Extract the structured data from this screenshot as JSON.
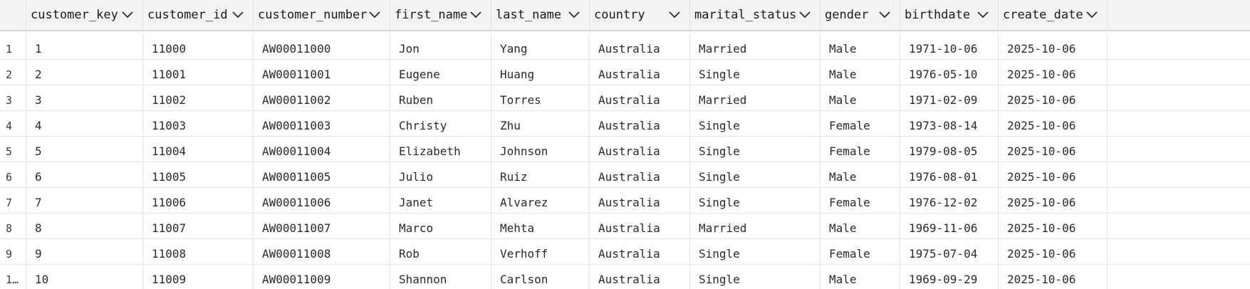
{
  "table": {
    "columns": [
      {
        "label": ""
      },
      {
        "label": "customer_key"
      },
      {
        "label": "customer_id"
      },
      {
        "label": "customer_number"
      },
      {
        "label": "first_name"
      },
      {
        "label": "last_name"
      },
      {
        "label": "country"
      },
      {
        "label": "marital_status"
      },
      {
        "label": "gender"
      },
      {
        "label": "birthdate"
      },
      {
        "label": "create_date"
      }
    ],
    "sort_icon": "chevron-down-icon",
    "rows": [
      {
        "n": "1",
        "cells": [
          "1",
          "11000",
          "AW00011000",
          "Jon",
          "Yang",
          "Australia",
          "Married",
          "Male",
          "1971-10-06",
          "2025-10-06"
        ]
      },
      {
        "n": "2",
        "cells": [
          "2",
          "11001",
          "AW00011001",
          "Eugene",
          "Huang",
          "Australia",
          "Single",
          "Male",
          "1976-05-10",
          "2025-10-06"
        ]
      },
      {
        "n": "3",
        "cells": [
          "3",
          "11002",
          "AW00011002",
          "Ruben",
          "Torres",
          "Australia",
          "Married",
          "Male",
          "1971-02-09",
          "2025-10-06"
        ]
      },
      {
        "n": "4",
        "cells": [
          "4",
          "11003",
          "AW00011003",
          "Christy",
          "Zhu",
          "Australia",
          "Single",
          "Female",
          "1973-08-14",
          "2025-10-06"
        ]
      },
      {
        "n": "5",
        "cells": [
          "5",
          "11004",
          "AW00011004",
          "Elizabeth",
          "Johnson",
          "Australia",
          "Single",
          "Female",
          "1979-08-05",
          "2025-10-06"
        ]
      },
      {
        "n": "6",
        "cells": [
          "6",
          "11005",
          "AW00011005",
          "Julio",
          "Ruiz",
          "Australia",
          "Single",
          "Male",
          "1976-08-01",
          "2025-10-06"
        ]
      },
      {
        "n": "7",
        "cells": [
          "7",
          "11006",
          "AW00011006",
          "Janet",
          "Alvarez",
          "Australia",
          "Single",
          "Female",
          "1976-12-02",
          "2025-10-06"
        ]
      },
      {
        "n": "8",
        "cells": [
          "8",
          "11007",
          "AW00011007",
          "Marco",
          "Mehta",
          "Australia",
          "Married",
          "Male",
          "1969-11-06",
          "2025-10-06"
        ]
      },
      {
        "n": "9",
        "cells": [
          "9",
          "11008",
          "AW00011008",
          "Rob",
          "Verhoff",
          "Australia",
          "Single",
          "Female",
          "1975-07-04",
          "2025-10-06"
        ]
      },
      {
        "n": "1…",
        "cells": [
          "10",
          "11009",
          "AW00011009",
          "Shannon",
          "Carlson",
          "Australia",
          "Single",
          "Male",
          "1969-09-29",
          "2025-10-06"
        ]
      }
    ]
  }
}
